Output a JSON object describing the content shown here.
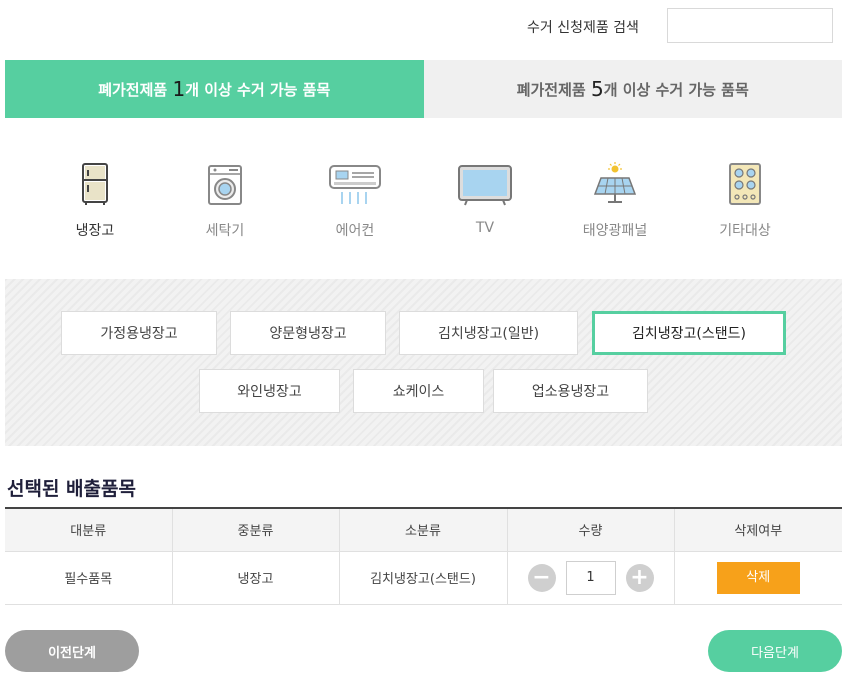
{
  "search": {
    "label": "수거 신청제품 검색",
    "value": "",
    "placeholder": ""
  },
  "tabs": [
    {
      "prefix": "폐가전제품 ",
      "number": "1",
      "suffix": "개 이상 수거 가능 품목",
      "active": true
    },
    {
      "prefix": "폐가전제품 ",
      "number": "5",
      "suffix": "개 이상 수거 가능 품목",
      "active": false
    }
  ],
  "categories": [
    {
      "label": "냉장고",
      "icon": "refrigerator-icon",
      "selected": true
    },
    {
      "label": "세탁기",
      "icon": "washing-machine-icon",
      "selected": false
    },
    {
      "label": "에어컨",
      "icon": "air-conditioner-icon",
      "selected": false
    },
    {
      "label": "TV",
      "icon": "tv-icon",
      "selected": false
    },
    {
      "label": "태양광패널",
      "icon": "solar-panel-icon",
      "selected": false
    },
    {
      "label": "기타대상",
      "icon": "other-appliance-icon",
      "selected": false
    }
  ],
  "subcategories": [
    {
      "label": "가정용냉장고",
      "selected": false
    },
    {
      "label": "양문형냉장고",
      "selected": false
    },
    {
      "label": "김치냉장고(일반)",
      "selected": false
    },
    {
      "label": "김치냉장고(스탠드)",
      "selected": true
    },
    {
      "label": "와인냉장고",
      "selected": false
    },
    {
      "label": "쇼케이스",
      "selected": false
    },
    {
      "label": "업소용냉장고",
      "selected": false
    }
  ],
  "selected_section": {
    "title": "선택된 배출품목",
    "columns": [
      "대분류",
      "중분류",
      "소분류",
      "수량",
      "삭제여부"
    ],
    "rows": [
      {
        "major": "필수품목",
        "middle": "냉장고",
        "minor": "김치냉장고(스탠드)",
        "quantity": "1",
        "delete_label": "삭제"
      }
    ]
  },
  "buttons": {
    "prev": "이전단계",
    "next": "다음단계"
  },
  "colors": {
    "accent": "#56cfa0",
    "delete": "#f7a11a",
    "prev": "#9e9e9e"
  }
}
